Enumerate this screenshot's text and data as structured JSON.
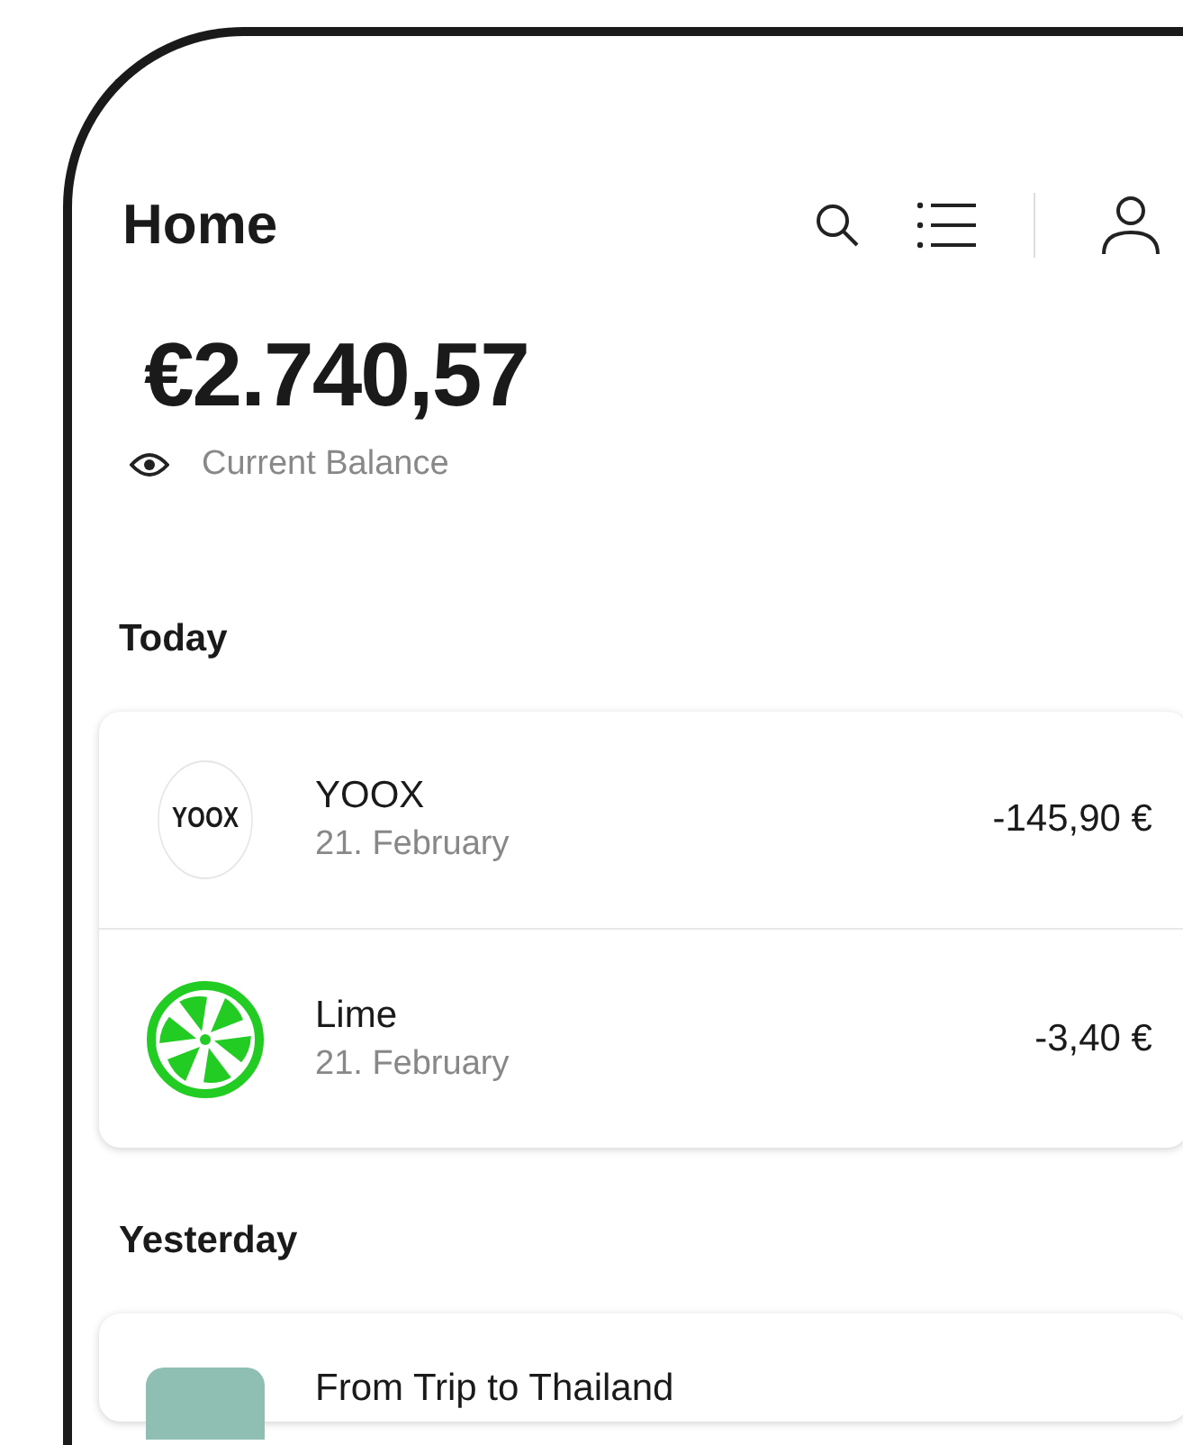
{
  "header": {
    "title": "Home"
  },
  "balance": {
    "amount": "€2.740,57",
    "label": "Current Balance"
  },
  "sections": [
    {
      "title": "Today",
      "transactions": [
        {
          "kind": "text_logo",
          "logo_text": "YOOX",
          "name": "YOOX",
          "date": "21. February",
          "amount": "-145,90 €"
        },
        {
          "kind": "lime",
          "name": "Lime",
          "date": "21. February",
          "amount": "-3,40 €"
        }
      ]
    },
    {
      "title": "Yesterday",
      "transactions": [
        {
          "kind": "tile",
          "name": "From Trip to Thailand"
        }
      ]
    }
  ]
}
